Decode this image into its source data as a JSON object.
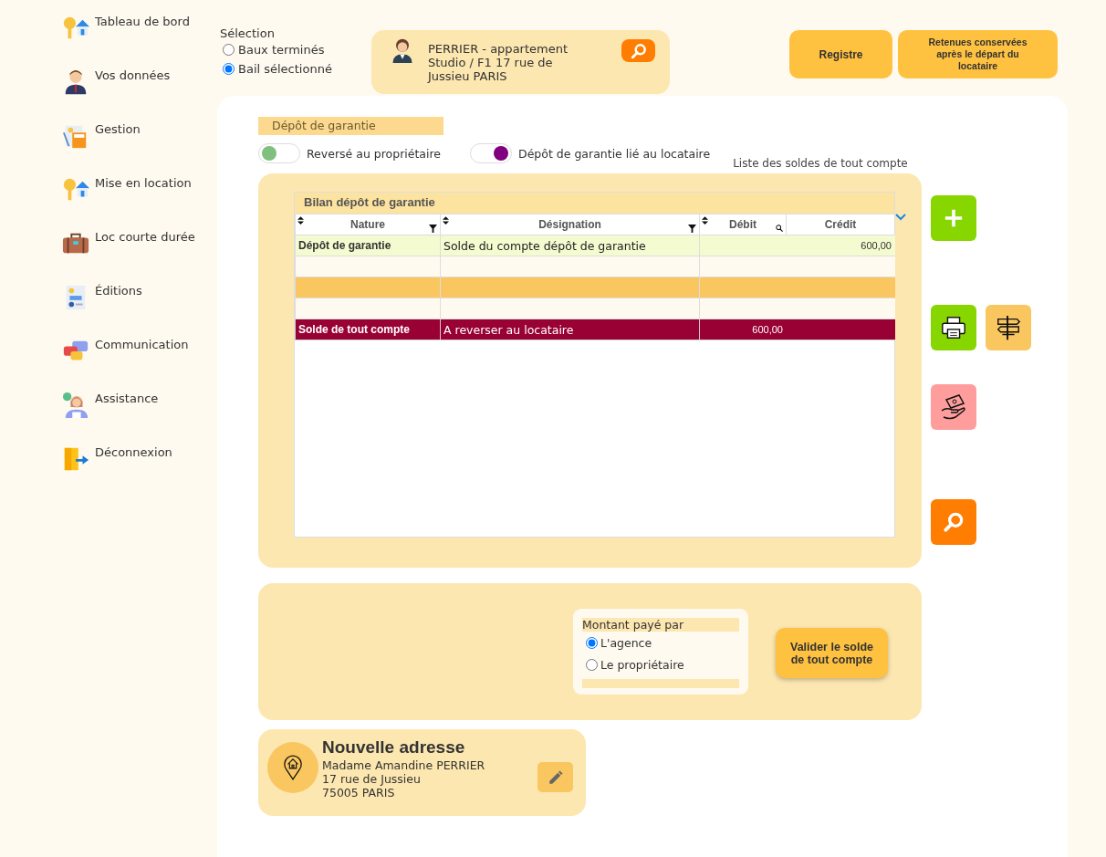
{
  "sidebar": {
    "items": [
      {
        "label": "Tableau de bord"
      },
      {
        "label": "Vos données"
      },
      {
        "label": "Gestion"
      },
      {
        "label": "Mise en location"
      },
      {
        "label": "Loc courte durée"
      },
      {
        "label": "Éditions"
      },
      {
        "label": "Communication"
      },
      {
        "label": "Assistance"
      },
      {
        "label": "Déconnexion"
      }
    ]
  },
  "selection": {
    "title": "Sélection",
    "options": [
      {
        "label": "Baux terminés",
        "selected": false
      },
      {
        "label": "Bail sélectionné",
        "selected": true
      }
    ]
  },
  "lease_card": {
    "lines": [
      "PERRIER - appartement",
      "Studio / F1 17 rue de",
      "Jussieu PARIS"
    ]
  },
  "header_buttons": [
    "Registre",
    "Retenues conservées après le départ du locataire"
  ],
  "section_title": "Dépôt de garantie",
  "toggles": [
    {
      "label": "Reversé au propriétaire",
      "on": false
    },
    {
      "label": "Dépôt de garantie lié au locataire",
      "on": true
    }
  ],
  "list_caption": "Liste des soldes de tout compte",
  "table": {
    "title": "Bilan dépôt de garantie",
    "columns": [
      "Nature",
      "Désignation",
      "Débit",
      "Crédit"
    ],
    "rows": [
      {
        "kind": "entry",
        "nature": "Dépôt de garantie",
        "designation": "Solde du compte dépôt de garantie",
        "credit": "600,00"
      },
      {
        "kind": "blank"
      },
      {
        "kind": "separator"
      },
      {
        "kind": "blank"
      },
      {
        "kind": "total",
        "nature": "Solde de tout compte",
        "designation": "A reverser au locataire",
        "debit": "600,00"
      }
    ]
  },
  "payment": {
    "title": "Montant payé par",
    "options": [
      {
        "label": "L'agence",
        "selected": true
      },
      {
        "label": "Le propriétaire",
        "selected": false
      }
    ]
  },
  "validate_button": "Valider le solde de tout compte",
  "address_card": {
    "title": "Nouvelle adresse",
    "lines": [
      "Madame Amandine PERRIER",
      "17 rue de Jussieu",
      "75005 PARIS"
    ]
  }
}
